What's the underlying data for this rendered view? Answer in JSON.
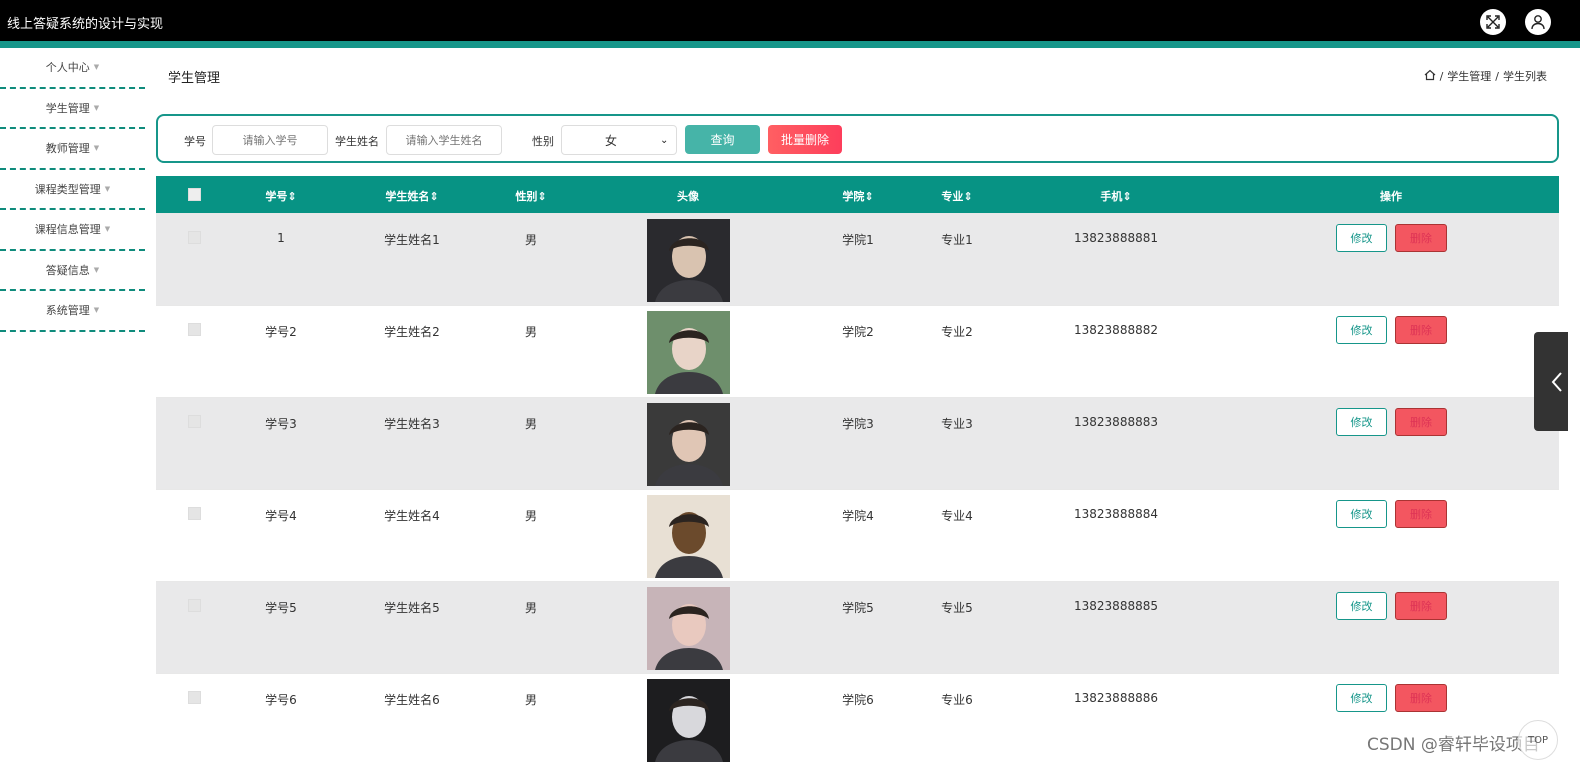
{
  "app": {
    "title": "线上答疑系统的设计与实现"
  },
  "colors": {
    "accent": "#16968a",
    "header_bg": "#079384",
    "delete": "#fd3e5b",
    "topbar": "#000000"
  },
  "topbar": {
    "icons": [
      "fullscreen-icon",
      "user-icon"
    ]
  },
  "sidebar": {
    "items": [
      {
        "label": "个人中心"
      },
      {
        "label": "学生管理"
      },
      {
        "label": "教师管理"
      },
      {
        "label": "课程类型管理"
      },
      {
        "label": "课程信息管理"
      },
      {
        "label": "答疑信息"
      },
      {
        "label": "系统管理"
      }
    ]
  },
  "page": {
    "title": "学生管理"
  },
  "breadcrumb": {
    "level1": "学生管理",
    "level2": "学生列表",
    "separator": "/"
  },
  "search": {
    "id_label": "学号",
    "id_placeholder": "请输入学号",
    "name_label": "学生姓名",
    "name_placeholder": "请输入学生姓名",
    "gender_label": "性别",
    "gender_value": "女",
    "query_label": "查询",
    "batch_delete_label": "批量删除"
  },
  "table": {
    "headers": {
      "id": "学号",
      "name": "学生姓名",
      "gender": "性别",
      "avatar": "头像",
      "college": "学院",
      "major": "专业",
      "phone": "手机",
      "actions": "操作"
    },
    "edit_label": "修改",
    "delete_label": "删除",
    "rows": [
      {
        "id": "1",
        "name": "学生姓名1",
        "gender": "男",
        "college": "学院1",
        "major": "专业1",
        "phone": "13823888881"
      },
      {
        "id": "学号2",
        "name": "学生姓名2",
        "gender": "男",
        "college": "学院2",
        "major": "专业2",
        "phone": "13823888882"
      },
      {
        "id": "学号3",
        "name": "学生姓名3",
        "gender": "男",
        "college": "学院3",
        "major": "专业3",
        "phone": "13823888883"
      },
      {
        "id": "学号4",
        "name": "学生姓名4",
        "gender": "男",
        "college": "学院4",
        "major": "专业4",
        "phone": "13823888884"
      },
      {
        "id": "学号5",
        "name": "学生姓名5",
        "gender": "男",
        "college": "学院5",
        "major": "专业5",
        "phone": "13823888885"
      },
      {
        "id": "学号6",
        "name": "学生姓名6",
        "gender": "男",
        "college": "学院6",
        "major": "专业6",
        "phone": "13823888886"
      }
    ]
  },
  "watermark": "CSDN @睿轩毕设项目",
  "back_to_top": "TOP"
}
